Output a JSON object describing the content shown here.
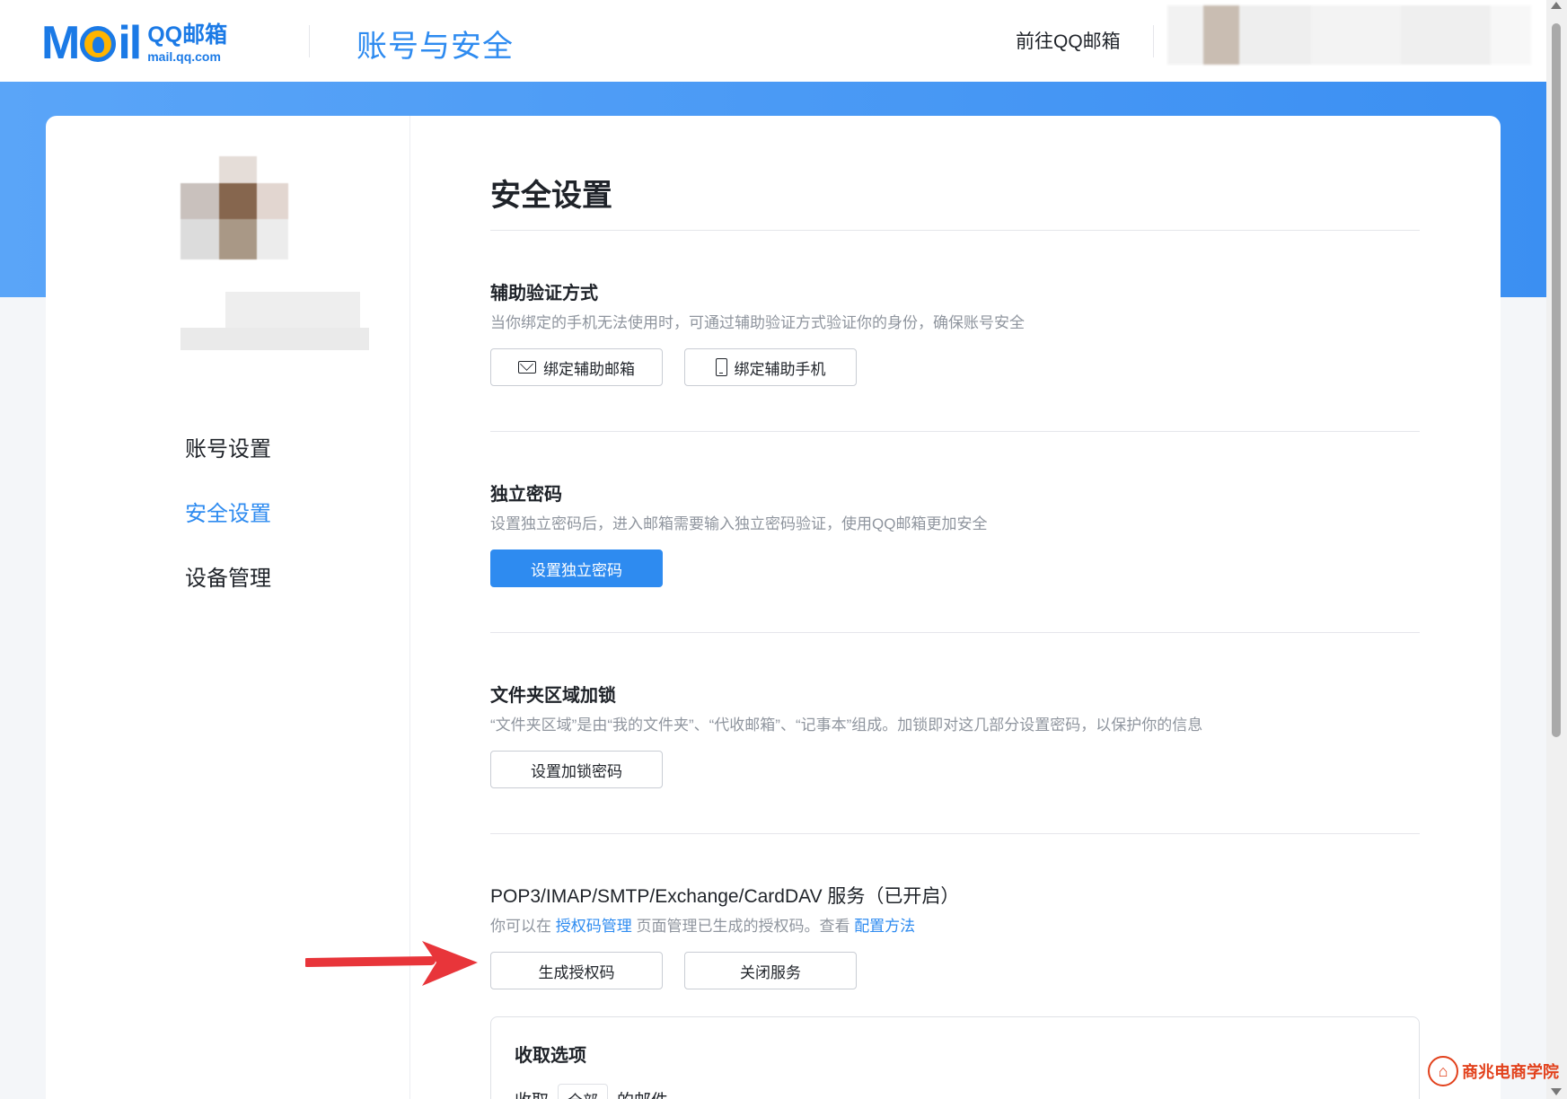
{
  "header": {
    "logo_mail": "Mail",
    "logo_cn": "QQ邮箱",
    "logo_en": "mail.qq.com",
    "app_title": "账号与安全",
    "goto_link": "前往QQ邮箱"
  },
  "sidebar": {
    "items": [
      {
        "label": "账号设置",
        "active": false
      },
      {
        "label": "安全设置",
        "active": true
      },
      {
        "label": "设备管理",
        "active": false
      }
    ]
  },
  "main": {
    "title": "安全设置",
    "sections": {
      "assist": {
        "title": "辅助验证方式",
        "desc": "当你绑定的手机无法使用时，可通过辅助验证方式验证你的身份，确保账号安全",
        "btn_email": "绑定辅助邮箱",
        "btn_phone": "绑定辅助手机"
      },
      "password": {
        "title": "独立密码",
        "desc": "设置独立密码后，进入邮箱需要输入独立密码验证，使用QQ邮箱更加安全",
        "btn": "设置独立密码"
      },
      "folder": {
        "title": "文件夹区域加锁",
        "desc": "“文件夹区域”是由“我的文件夹”、“代收邮箱”、“记事本”组成。加锁即对这几部分设置密码，以保护你的信息",
        "btn": "设置加锁密码"
      },
      "pop": {
        "title": "POP3/IMAP/SMTP/Exchange/CardDAV 服务（已开启）",
        "desc_prefix": "你可以在 ",
        "desc_link1": "授权码管理",
        "desc_mid": " 页面管理已生成的授权码。查看 ",
        "desc_link2": "配置方法",
        "btn_generate": "生成授权码",
        "btn_close": "关闭服务"
      }
    },
    "options": {
      "title": "收取选项",
      "row_prefix": "收取",
      "select_value": "全部",
      "row_suffix": "的邮件"
    }
  },
  "watermark": {
    "text": "商兆电商学院"
  },
  "colors": {
    "accent": "#2e8bf0",
    "arrow": "#e8353a"
  }
}
